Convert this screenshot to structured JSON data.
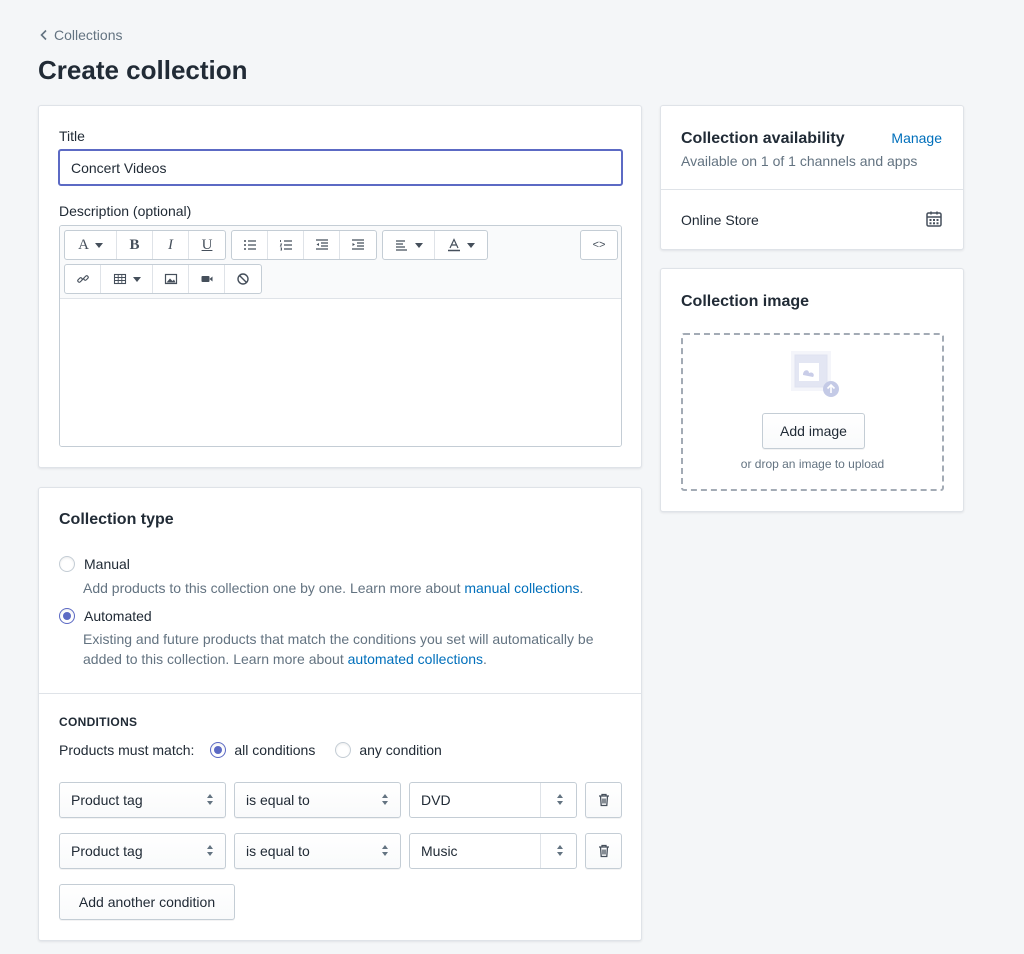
{
  "breadcrumb": {
    "label": "Collections"
  },
  "page": {
    "title": "Create collection"
  },
  "details": {
    "title_label": "Title",
    "title_value": "Concert Videos",
    "description_label": "Description (optional)"
  },
  "editor_toolbar": {
    "icons": [
      "font-icon",
      "bold-icon",
      "italic-icon",
      "underline-icon",
      "bullet-list-icon",
      "numbered-list-icon",
      "outdent-icon",
      "indent-icon",
      "align-icon",
      "text-color-icon",
      "html-code-icon",
      "link-icon",
      "table-icon",
      "image-icon",
      "video-icon",
      "clear-format-icon"
    ],
    "font_glyph": "A",
    "bold_glyph": "B",
    "italic_glyph": "I",
    "underline_glyph": "U",
    "code_glyph": "<>"
  },
  "collection_type": {
    "heading": "Collection type",
    "manual": {
      "label": "Manual",
      "help": "Add products to this collection one by one. Learn more about ",
      "link": "manual collections",
      "selected": false
    },
    "automated": {
      "label": "Automated",
      "help": "Existing and future products that match the conditions you set will automatically be added to this collection. Learn more about ",
      "link": "automated collections",
      "selected": true
    }
  },
  "conditions": {
    "heading": "CONDITIONS",
    "match_label": "Products must match:",
    "all_label": "all conditions",
    "any_label": "any condition",
    "match_mode": "all",
    "rows": [
      {
        "field": "Product tag",
        "operator": "is equal to",
        "value": "DVD"
      },
      {
        "field": "Product tag",
        "operator": "is equal to",
        "value": "Music"
      }
    ],
    "add_button": "Add another condition"
  },
  "availability": {
    "heading": "Collection availability",
    "manage_link": "Manage",
    "subtitle": "Available on 1 of 1 channels and apps",
    "channel": "Online Store"
  },
  "collection_image": {
    "heading": "Collection image",
    "add_button": "Add image",
    "hint": "or drop an image to upload"
  },
  "colors": {
    "accent": "#5c6ac4",
    "link": "#006fbb",
    "background": "#f4f6f8",
    "subdued_text": "#637381"
  }
}
